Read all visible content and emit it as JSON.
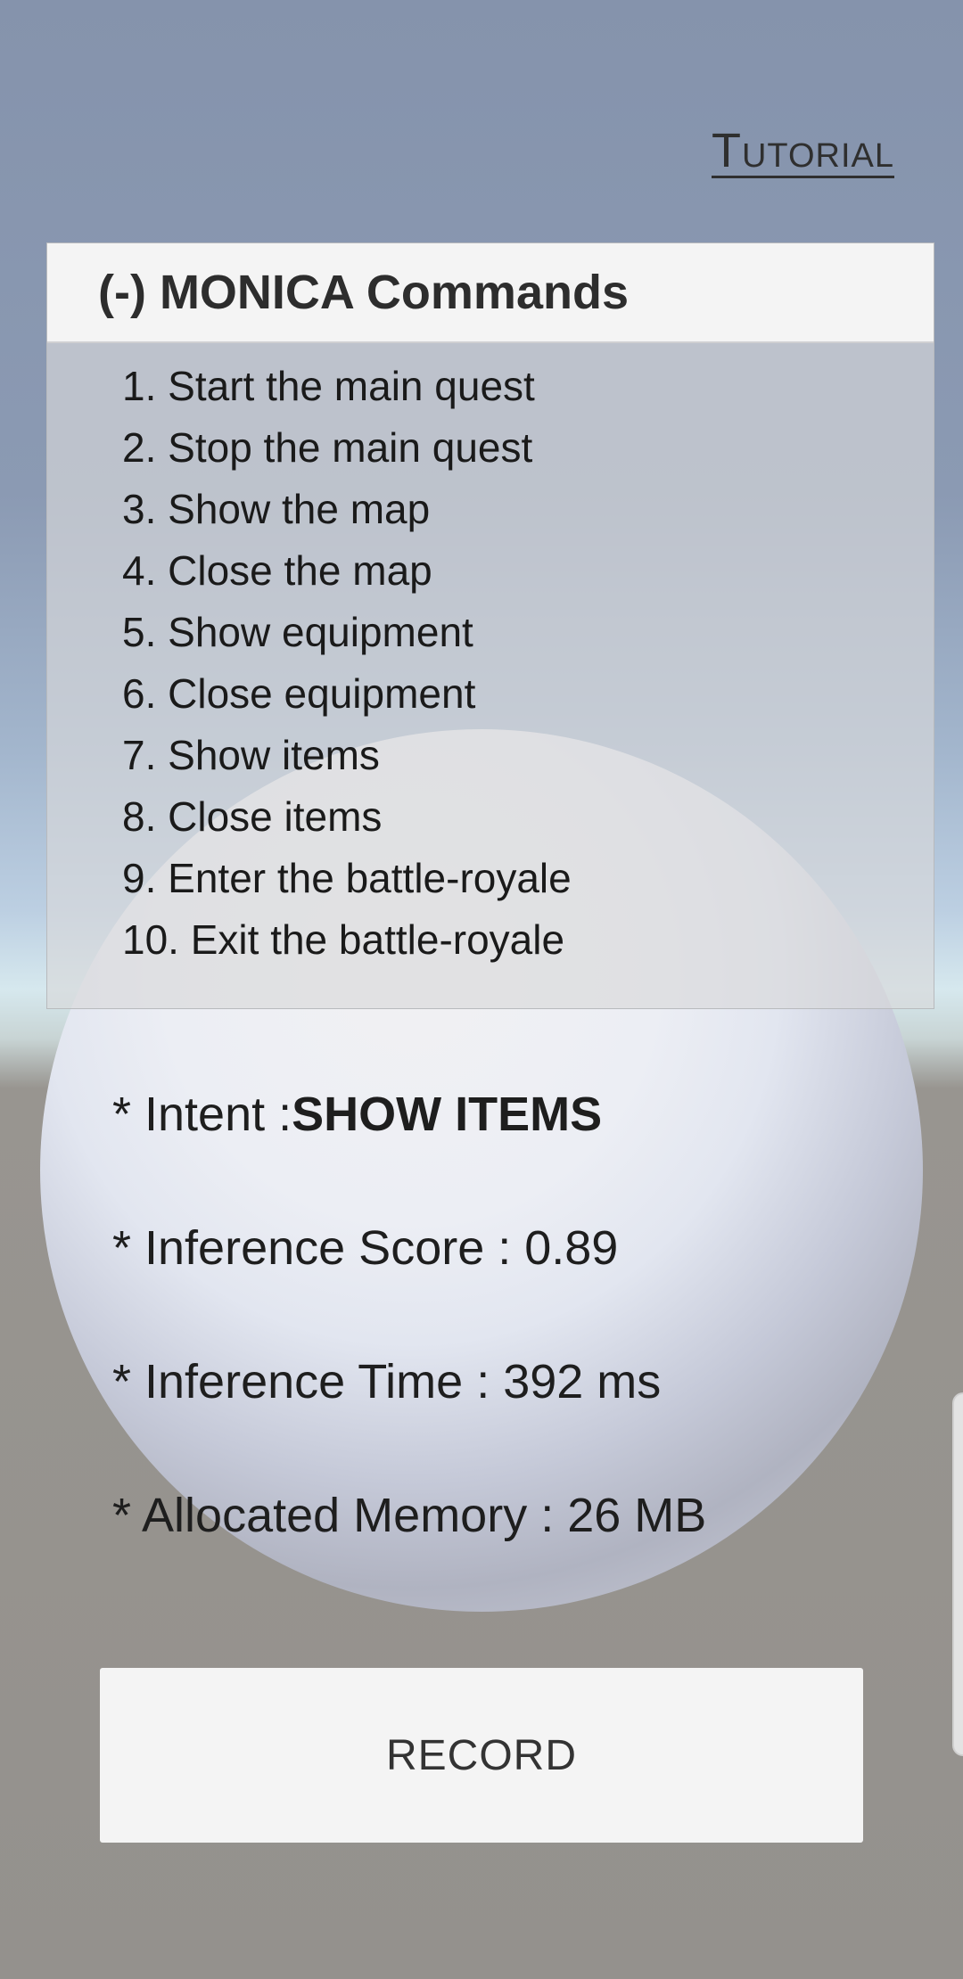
{
  "header": {
    "tutorial_label": "Tutorial"
  },
  "commands_panel": {
    "title": "(-) MONICA Commands",
    "items": [
      "1. Start the main quest",
      "2. Stop the main quest",
      "3. Show the map",
      "4. Close the map",
      "5. Show equipment",
      "6. Close equipment",
      "7. Show items",
      "8. Close items",
      "9. Enter the battle-royale",
      "10. Exit the battle-royale"
    ]
  },
  "results": {
    "intent_label": "* Intent :",
    "intent_value": "SHOW ITEMS",
    "score_text": "* Inference Score : 0.89",
    "time_text": "* Inference Time : 392 ms",
    "memory_text": "* Allocated Memory : 26 MB"
  },
  "record_button": {
    "label": "RECORD"
  },
  "icons": {
    "scroll_handle": "scroll-handle-icon"
  },
  "colors": {
    "panel_header": "#f4f4f4",
    "button_bg": "#f4f4f4",
    "text": "#1e1e1e"
  }
}
